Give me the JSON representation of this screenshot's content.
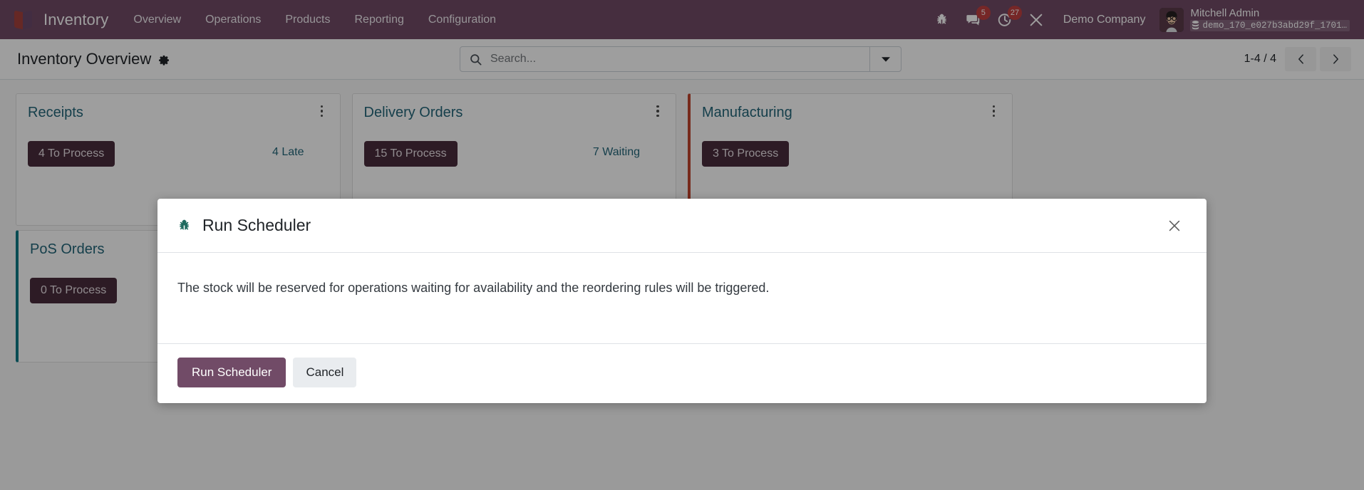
{
  "navbar": {
    "brand": "Inventory",
    "brand_logo_icon": "odoo-cube-icon",
    "menu": [
      {
        "label": "Overview"
      },
      {
        "label": "Operations"
      },
      {
        "label": "Products"
      },
      {
        "label": "Reporting"
      },
      {
        "label": "Configuration"
      }
    ],
    "systray": {
      "debug": {
        "icon": "bug-icon",
        "badge": ""
      },
      "messaging": {
        "icon": "chat-bubble-icon",
        "badge": "5"
      },
      "activities": {
        "icon": "clock-icon",
        "badge": "27"
      },
      "tools": {
        "icon": "wrench-cross-icon",
        "badge": ""
      }
    },
    "company": "Demo Company",
    "user": {
      "name": "Mitchell Admin",
      "database": "demo_170_e027b3abd29f_1701…",
      "database_icon": "database-icon",
      "avatar_icon": "user-avatar"
    },
    "accent_color": "#714b67",
    "badge_color": "#bf4040"
  },
  "control_panel": {
    "breadcrumb": "Inventory Overview",
    "settings_icon": "gear-icon",
    "search": {
      "icon": "search-icon",
      "value": "",
      "placeholder": "Search...",
      "dropdown_icon": "caret-down-icon"
    },
    "pager": {
      "value": "1-4 / 4",
      "previous_icon": "chevron-left-icon",
      "next_icon": "chevron-right-icon"
    }
  },
  "kanban": {
    "cards": [
      {
        "title": "Receipts",
        "menu_icon": "vertical-dots-icon",
        "process_button": "4 To Process",
        "stats": [
          {
            "label": "4 Late"
          }
        ],
        "accent": "none"
      },
      {
        "title": "Delivery Orders",
        "menu_icon": "vertical-dots-icon",
        "process_button": "15 To Process",
        "stats": [
          {
            "label": "7 Waiting"
          }
        ],
        "accent": "none"
      },
      {
        "title": "Manufacturing",
        "menu_icon": "vertical-dots-icon",
        "process_button": "3 To Process",
        "stats": [],
        "accent": "red",
        "accent_color": "#c0442e"
      },
      {
        "title": "PoS Orders",
        "menu_icon": "vertical-dots-icon",
        "process_button": "0 To Process",
        "stats": [],
        "accent": "teal",
        "accent_color": "#0f7b86"
      }
    ]
  },
  "modal": {
    "icon": "bug-icon",
    "title": "Run Scheduler",
    "close_icon": "close-icon",
    "body_text": "The stock will be reserved for operations waiting for availability and the reordering rules will be triggered.",
    "confirm_label": "Run Scheduler",
    "cancel_label": "Cancel",
    "confirm_color": "#714b67"
  }
}
